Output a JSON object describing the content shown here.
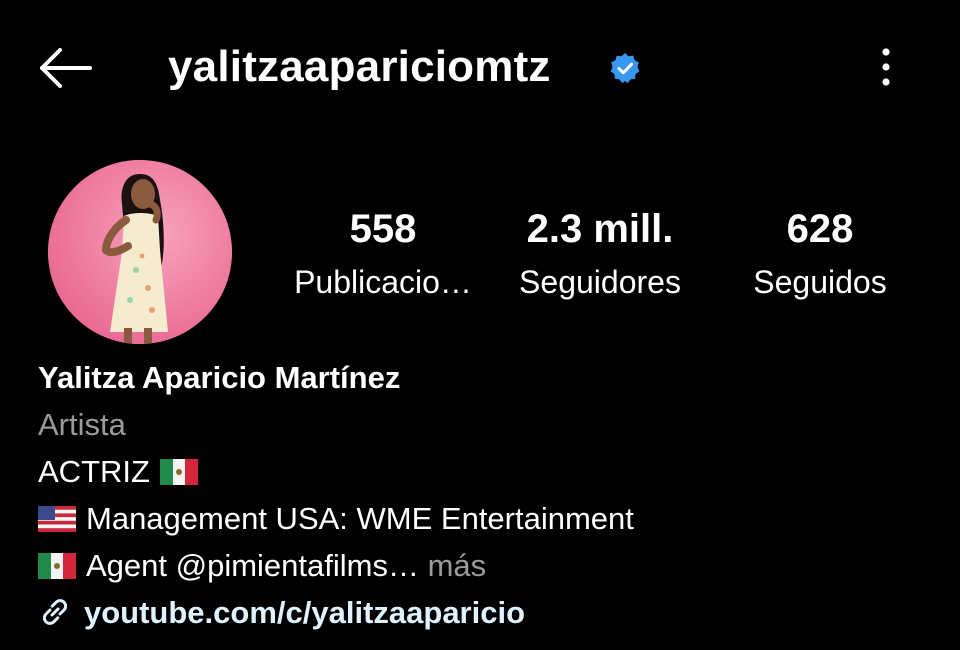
{
  "header": {
    "username": "yalitzaapariciomtz",
    "back_icon": "arrow-left-icon",
    "verified_icon": "verified-badge-icon",
    "menu_icon": "more-vertical-icon",
    "verified_color": "#3897f0"
  },
  "stats": [
    {
      "value": "558",
      "label": "Publicacio…"
    },
    {
      "value": "2.3 mill.",
      "label": "Seguidores"
    },
    {
      "value": "628",
      "label": "Seguidos"
    }
  ],
  "profile": {
    "name": "Yalitza Aparicio Martínez",
    "category": "Artista",
    "bio_line1": "ACTRIZ",
    "bio_line2": "Management  USA: WME Entertainment",
    "bio_line3": "Agent @pimientafilms…",
    "more": "más",
    "link": "youtube.com/c/yalitzaaparicio"
  }
}
